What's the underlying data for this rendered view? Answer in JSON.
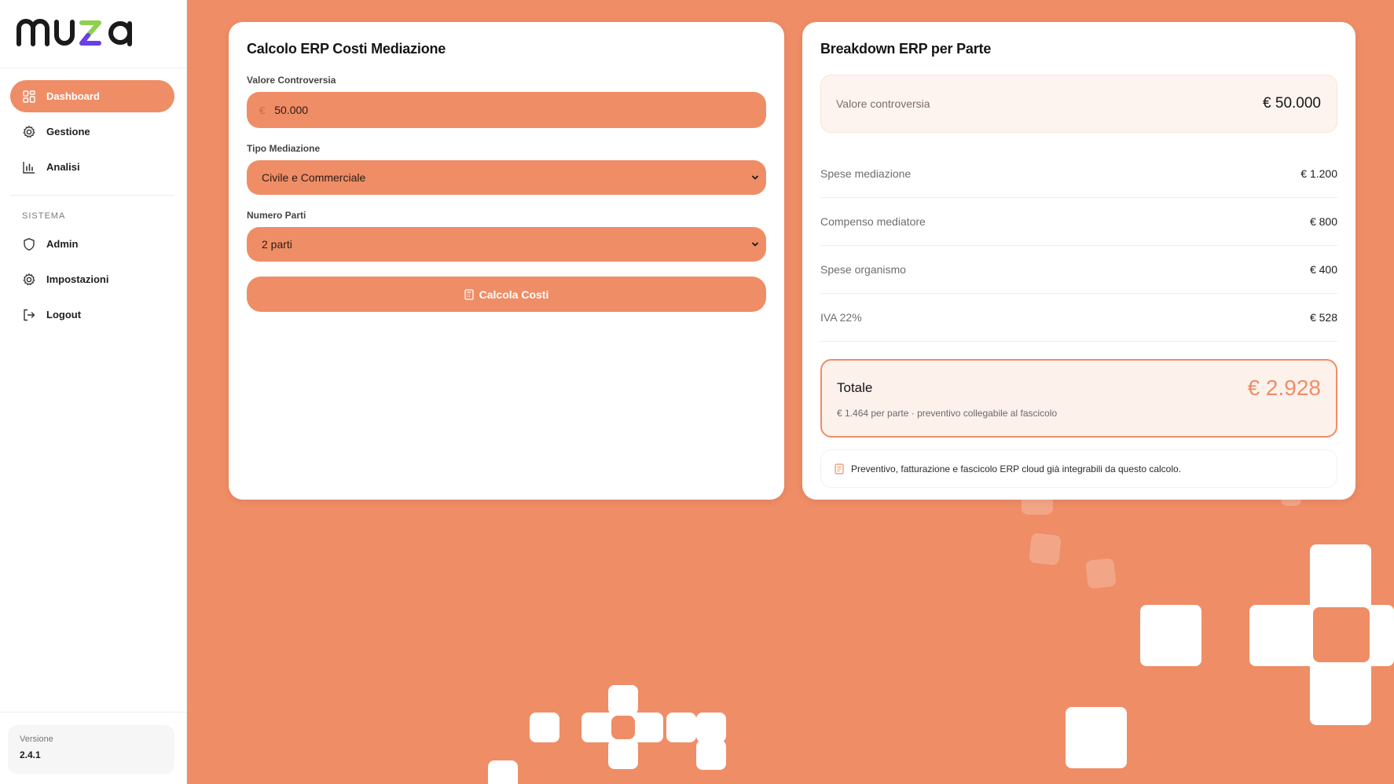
{
  "brand": {
    "name": "muza",
    "colors": {
      "accent": "#ef8d66",
      "logo_z_top": "#8fd14f",
      "logo_z_bottom": "#6a3fe3"
    }
  },
  "sidebar": {
    "items": [
      {
        "label": "Dashboard",
        "icon": "dashboard-icon",
        "active": true
      },
      {
        "label": "Gestione",
        "icon": "gear-icon"
      },
      {
        "label": "Analisi",
        "icon": "bar-chart-icon"
      }
    ],
    "section_label": "SISTEMA",
    "system_items": [
      {
        "label": "Admin",
        "icon": "shield-icon"
      },
      {
        "label": "Impostazioni",
        "icon": "gear-icon"
      },
      {
        "label": "Logout",
        "icon": "logout-icon"
      }
    ],
    "version": {
      "label": "Versione",
      "value": "2.4.1"
    }
  },
  "calculator": {
    "title": "Calcolo ERP Costi Mediazione",
    "valore": {
      "label": "Valore Controversia",
      "currency": "€",
      "value": "50.000"
    },
    "tipo": {
      "label": "Tipo Mediazione",
      "selected": "Civile e Commerciale"
    },
    "parti": {
      "label": "Numero Parti",
      "selected": "2 parti"
    },
    "button_label": "Calcola Costi",
    "button_icon": "calculator-icon"
  },
  "breakdown": {
    "title": "Breakdown ERP per Parte",
    "valore_controversia": {
      "label": "Valore controversia",
      "value": "€ 50.000"
    },
    "rows": [
      {
        "label": "Spese mediazione",
        "value": "€ 1.200"
      },
      {
        "label": "Compenso mediatore",
        "value": "€ 800"
      },
      {
        "label": "Spese organismo",
        "value": "€ 400"
      },
      {
        "label": "IVA 22%",
        "value": "€ 528"
      }
    ],
    "total": {
      "label": "Totale",
      "value": "€ 2.928",
      "subtitle": "€ 1.464 per parte · preventivo collegabile al fascicolo"
    },
    "note": {
      "icon": "document-icon",
      "text": "Preventivo, fatturazione e fascicolo ERP cloud già integrabili da questo calcolo."
    }
  }
}
